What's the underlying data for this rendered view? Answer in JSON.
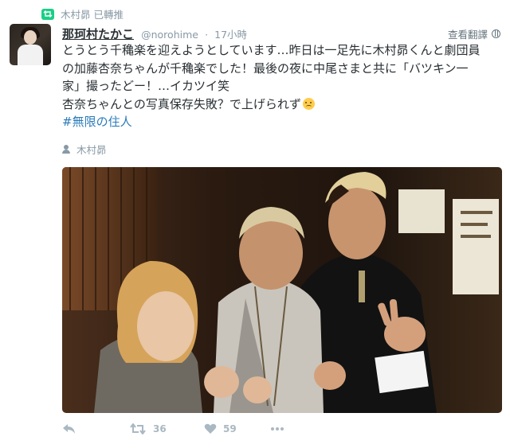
{
  "retweet_context": {
    "text": "木村昴 已轉推",
    "icon": "retweet-icon",
    "color": "#19cf86"
  },
  "author": {
    "display_name": "那珂村たかこ",
    "handle": "@norohime",
    "time": "17小時"
  },
  "translate_label": "查看翻譯",
  "tweet": {
    "lines": [
      "とうとう千穐楽を迎えようとしています…昨日は一足先に木村昴くんと劇団員",
      "の加藤杏奈ちゃんが千穐楽でした！最後の夜に中尾さまと共に「バツキン一",
      "家」撮ったどー！…イカツイ笑",
      "杏奈ちゃんとの写真保存失敗？で上げられず"
    ],
    "hashtag": "#無限の住人"
  },
  "tagged_user": "木村昴",
  "actions": {
    "reply_icon": "reply-icon",
    "retweet_icon": "retweet-icon",
    "retweet_count": "36",
    "like_icon": "heart-icon",
    "like_count": "59",
    "more_icon": "more-icon"
  },
  "colors": {
    "link": "#2b7bb9",
    "muted": "#8899a6",
    "icon": "#aab8c2",
    "text": "#292f33"
  }
}
